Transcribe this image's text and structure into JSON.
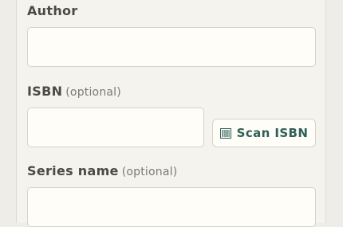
{
  "author": {
    "label": "Author",
    "value": ""
  },
  "isbn": {
    "label": "ISBN",
    "optional": "(optional)",
    "value": ""
  },
  "scan_button": {
    "label": "Scan ISBN",
    "icon": "barcode-icon",
    "color": "#2f5f58"
  },
  "series_name": {
    "label": "Series name",
    "optional": "(optional)",
    "value": ""
  }
}
